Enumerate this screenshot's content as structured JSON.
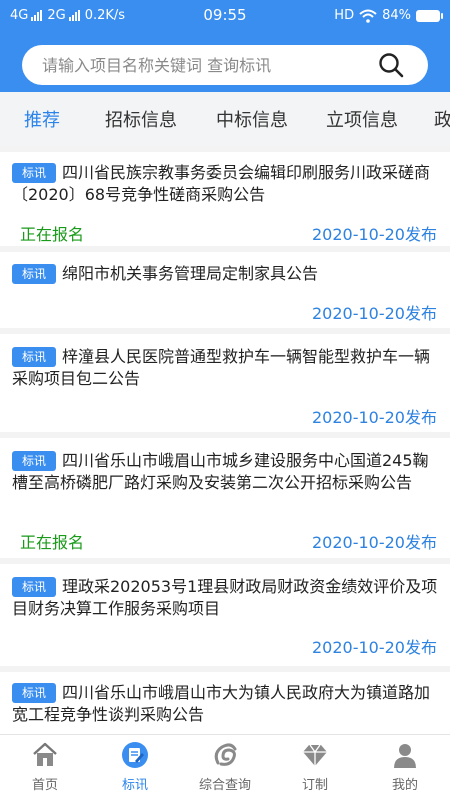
{
  "status_bar": {
    "network_1": "4G",
    "network_2": "2G",
    "speed": "0.2K/s",
    "time": "09:55",
    "hd": "HD",
    "battery": "84%"
  },
  "search": {
    "placeholder": "请输入项目名称关键词 查询标讯"
  },
  "tabs": [
    {
      "label": "推荐",
      "active": true
    },
    {
      "label": "招标信息",
      "active": false
    },
    {
      "label": "中标信息",
      "active": false
    },
    {
      "label": "立项信息",
      "active": false
    },
    {
      "label": "政",
      "active": false
    }
  ],
  "items": [
    {
      "badge": "标讯",
      "title": "四川省民族宗教事务委员会编辑印刷服务川政采磋商〔2020〕68号竞争性磋商采购公告",
      "status": "正在报名",
      "date": "2020-10-20发布"
    },
    {
      "badge": "标讯",
      "title": "绵阳市机关事务管理局定制家具公告",
      "status": "",
      "date": "2020-10-20发布"
    },
    {
      "badge": "标讯",
      "title": "梓潼县人民医院普通型救护车一辆智能型救护车一辆采购项目包二公告",
      "status": "",
      "date": "2020-10-20发布"
    },
    {
      "badge": "标讯",
      "title": "四川省乐山市峨眉山市城乡建设服务中心国道245鞠槽至高桥磷肥厂路灯采购及安装第二次公开招标采购公告",
      "status": "正在报名",
      "date": "2020-10-20发布"
    },
    {
      "badge": "标讯",
      "title": "理政采202053号1理县财政局财政资金绩效评价及项目财务决算工作服务采购项目",
      "status": "",
      "date": "2020-10-20发布"
    },
    {
      "badge": "标讯",
      "title": "四川省乐山市峨眉山市大为镇人民政府大为镇道路加宽工程竞争性谈判采购公告",
      "status": "",
      "date": ""
    }
  ],
  "nav": [
    {
      "label": "首页",
      "icon": "home-icon",
      "active": false
    },
    {
      "label": "标讯",
      "icon": "bid-news-icon",
      "active": true
    },
    {
      "label": "综合查询",
      "icon": "search-logo-icon",
      "active": false
    },
    {
      "label": "订制",
      "icon": "diamond-icon",
      "active": false
    },
    {
      "label": "我的",
      "icon": "user-icon",
      "active": false
    }
  ],
  "colors": {
    "primary": "#3a8ef0",
    "status_green": "#1a9a1a",
    "date_blue": "#2e82e0"
  }
}
